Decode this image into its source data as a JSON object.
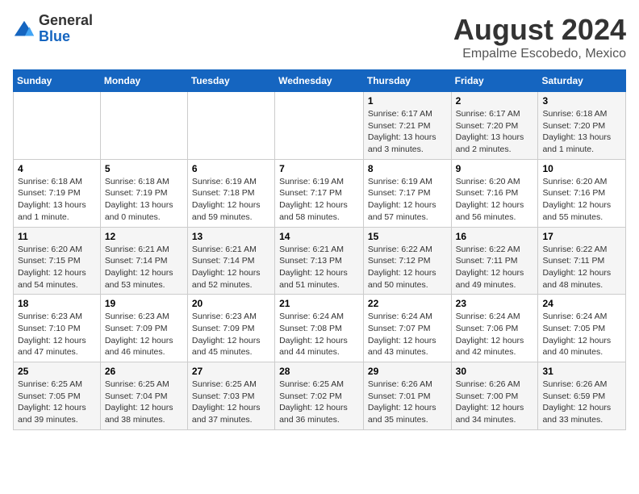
{
  "header": {
    "logo_general": "General",
    "logo_blue": "Blue",
    "month_title": "August 2024",
    "subtitle": "Empalme Escobedo, Mexico"
  },
  "days_of_week": [
    "Sunday",
    "Monday",
    "Tuesday",
    "Wednesday",
    "Thursday",
    "Friday",
    "Saturday"
  ],
  "weeks": [
    [
      {
        "day": "",
        "info": ""
      },
      {
        "day": "",
        "info": ""
      },
      {
        "day": "",
        "info": ""
      },
      {
        "day": "",
        "info": ""
      },
      {
        "day": "1",
        "info": "Sunrise: 6:17 AM\nSunset: 7:21 PM\nDaylight: 13 hours\nand 3 minutes."
      },
      {
        "day": "2",
        "info": "Sunrise: 6:17 AM\nSunset: 7:20 PM\nDaylight: 13 hours\nand 2 minutes."
      },
      {
        "day": "3",
        "info": "Sunrise: 6:18 AM\nSunset: 7:20 PM\nDaylight: 13 hours\nand 1 minute."
      }
    ],
    [
      {
        "day": "4",
        "info": "Sunrise: 6:18 AM\nSunset: 7:19 PM\nDaylight: 13 hours\nand 1 minute."
      },
      {
        "day": "5",
        "info": "Sunrise: 6:18 AM\nSunset: 7:19 PM\nDaylight: 13 hours\nand 0 minutes."
      },
      {
        "day": "6",
        "info": "Sunrise: 6:19 AM\nSunset: 7:18 PM\nDaylight: 12 hours\nand 59 minutes."
      },
      {
        "day": "7",
        "info": "Sunrise: 6:19 AM\nSunset: 7:17 PM\nDaylight: 12 hours\nand 58 minutes."
      },
      {
        "day": "8",
        "info": "Sunrise: 6:19 AM\nSunset: 7:17 PM\nDaylight: 12 hours\nand 57 minutes."
      },
      {
        "day": "9",
        "info": "Sunrise: 6:20 AM\nSunset: 7:16 PM\nDaylight: 12 hours\nand 56 minutes."
      },
      {
        "day": "10",
        "info": "Sunrise: 6:20 AM\nSunset: 7:16 PM\nDaylight: 12 hours\nand 55 minutes."
      }
    ],
    [
      {
        "day": "11",
        "info": "Sunrise: 6:20 AM\nSunset: 7:15 PM\nDaylight: 12 hours\nand 54 minutes."
      },
      {
        "day": "12",
        "info": "Sunrise: 6:21 AM\nSunset: 7:14 PM\nDaylight: 12 hours\nand 53 minutes."
      },
      {
        "day": "13",
        "info": "Sunrise: 6:21 AM\nSunset: 7:14 PM\nDaylight: 12 hours\nand 52 minutes."
      },
      {
        "day": "14",
        "info": "Sunrise: 6:21 AM\nSunset: 7:13 PM\nDaylight: 12 hours\nand 51 minutes."
      },
      {
        "day": "15",
        "info": "Sunrise: 6:22 AM\nSunset: 7:12 PM\nDaylight: 12 hours\nand 50 minutes."
      },
      {
        "day": "16",
        "info": "Sunrise: 6:22 AM\nSunset: 7:11 PM\nDaylight: 12 hours\nand 49 minutes."
      },
      {
        "day": "17",
        "info": "Sunrise: 6:22 AM\nSunset: 7:11 PM\nDaylight: 12 hours\nand 48 minutes."
      }
    ],
    [
      {
        "day": "18",
        "info": "Sunrise: 6:23 AM\nSunset: 7:10 PM\nDaylight: 12 hours\nand 47 minutes."
      },
      {
        "day": "19",
        "info": "Sunrise: 6:23 AM\nSunset: 7:09 PM\nDaylight: 12 hours\nand 46 minutes."
      },
      {
        "day": "20",
        "info": "Sunrise: 6:23 AM\nSunset: 7:09 PM\nDaylight: 12 hours\nand 45 minutes."
      },
      {
        "day": "21",
        "info": "Sunrise: 6:24 AM\nSunset: 7:08 PM\nDaylight: 12 hours\nand 44 minutes."
      },
      {
        "day": "22",
        "info": "Sunrise: 6:24 AM\nSunset: 7:07 PM\nDaylight: 12 hours\nand 43 minutes."
      },
      {
        "day": "23",
        "info": "Sunrise: 6:24 AM\nSunset: 7:06 PM\nDaylight: 12 hours\nand 42 minutes."
      },
      {
        "day": "24",
        "info": "Sunrise: 6:24 AM\nSunset: 7:05 PM\nDaylight: 12 hours\nand 40 minutes."
      }
    ],
    [
      {
        "day": "25",
        "info": "Sunrise: 6:25 AM\nSunset: 7:05 PM\nDaylight: 12 hours\nand 39 minutes."
      },
      {
        "day": "26",
        "info": "Sunrise: 6:25 AM\nSunset: 7:04 PM\nDaylight: 12 hours\nand 38 minutes."
      },
      {
        "day": "27",
        "info": "Sunrise: 6:25 AM\nSunset: 7:03 PM\nDaylight: 12 hours\nand 37 minutes."
      },
      {
        "day": "28",
        "info": "Sunrise: 6:25 AM\nSunset: 7:02 PM\nDaylight: 12 hours\nand 36 minutes."
      },
      {
        "day": "29",
        "info": "Sunrise: 6:26 AM\nSunset: 7:01 PM\nDaylight: 12 hours\nand 35 minutes."
      },
      {
        "day": "30",
        "info": "Sunrise: 6:26 AM\nSunset: 7:00 PM\nDaylight: 12 hours\nand 34 minutes."
      },
      {
        "day": "31",
        "info": "Sunrise: 6:26 AM\nSunset: 6:59 PM\nDaylight: 12 hours\nand 33 minutes."
      }
    ]
  ]
}
